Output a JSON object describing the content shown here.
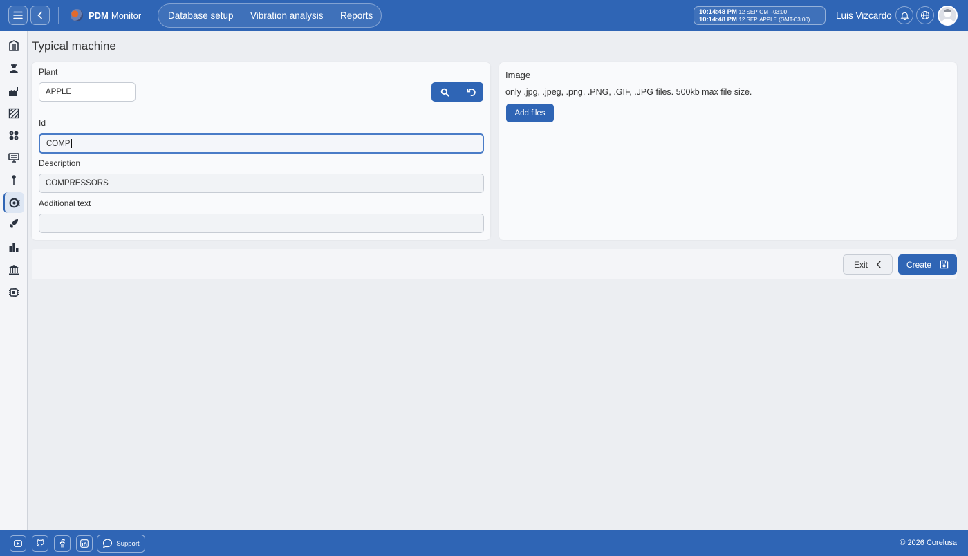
{
  "app": {
    "name_bold": "PDM",
    "name_rest": "Monitor"
  },
  "nav": {
    "items": [
      "Database setup",
      "Vibration analysis",
      "Reports"
    ]
  },
  "clock": {
    "line1_time": "10:14:48 PM",
    "line1_date": "12 SEP",
    "line1_zone": "GMT-03:00",
    "line2_time": "10:14:48 PM",
    "line2_date": "12 SEP",
    "line2_zone": "APPLE (GMT-03:00)"
  },
  "user": {
    "name": "Luis Vizcardo"
  },
  "sidebar": {
    "icons": [
      "building-icon",
      "worker-icon",
      "factory-icon",
      "area-icon",
      "gears-icon",
      "monitor-icon",
      "pin-icon",
      "machine-icon",
      "rocket-icon",
      "chart-icon",
      "bank-icon",
      "chip-icon"
    ],
    "active_index": 7
  },
  "page": {
    "title": "Typical machine"
  },
  "form": {
    "plant_label": "Plant",
    "plant_value": "APPLE",
    "id_label": "Id",
    "id_value": "COMP",
    "description_label": "Description",
    "description_value": "COMPRESSORS",
    "additional_label": "Additional text",
    "additional_value": ""
  },
  "image": {
    "label": "Image",
    "hint": "only .jpg, .jpeg, .png, .PNG, .GIF, .JPG files. 500kb max file size.",
    "add_label": "Add files"
  },
  "actions": {
    "exit_label": "Exit",
    "create_label": "Create"
  },
  "footer": {
    "support_label": "Support",
    "copyright": "© 2026 Corelusa"
  },
  "colors": {
    "primary": "#2f65b5",
    "background": "#eceef2"
  }
}
